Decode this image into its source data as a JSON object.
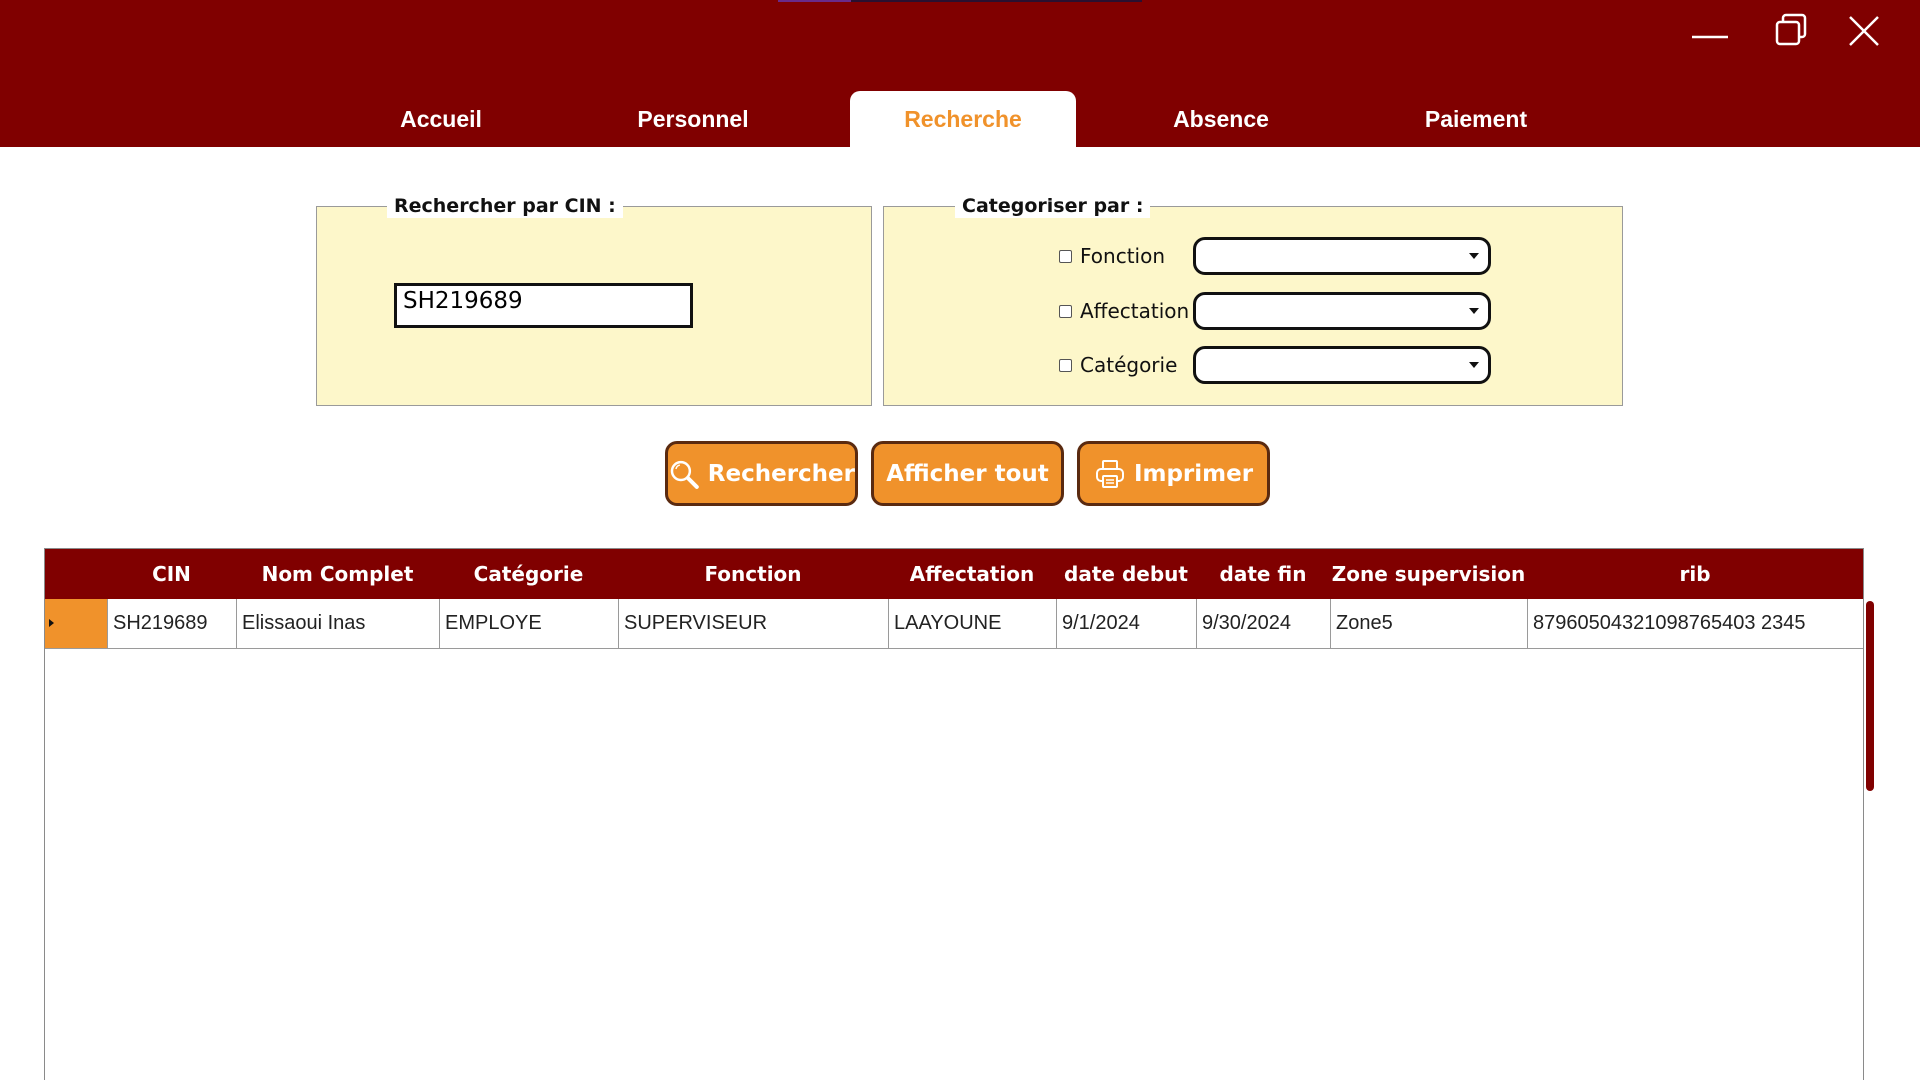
{
  "window": {
    "minimize_icon": "minimize-icon",
    "maximize_icon": "restore-icon",
    "close_icon": "close-icon"
  },
  "tabs": [
    {
      "label": "Accueil",
      "active": false
    },
    {
      "label": "Personnel",
      "active": false
    },
    {
      "label": "Recherche",
      "active": true
    },
    {
      "label": "Absence",
      "active": false
    },
    {
      "label": "Paiement",
      "active": false
    }
  ],
  "search_cin": {
    "legend": "Rechercher par CIN :",
    "value": "SH219689"
  },
  "categorize": {
    "legend": "Categoriser par :",
    "filters": [
      {
        "label": "Fonction",
        "checked": false,
        "selected": ""
      },
      {
        "label": "Affectation",
        "checked": false,
        "selected": ""
      },
      {
        "label": "Catégorie",
        "checked": false,
        "selected": ""
      }
    ]
  },
  "actions": {
    "search_label": "Rechercher",
    "show_all_label": "Afficher tout",
    "print_label": "Imprimer"
  },
  "table": {
    "columns": [
      "CIN",
      "Nom Complet",
      "Catégorie",
      "Fonction",
      "Affectation",
      "date debut",
      "date fin",
      "Zone supervision",
      "rib"
    ],
    "rows": [
      [
        "SH219689",
        "Elissaoui Inas",
        "EMPLOYE",
        "SUPERVISEUR",
        "LAAYOUNE",
        "9/1/2024",
        "9/30/2024",
        "Zone5",
        "87960504321098765403 2345"
      ]
    ]
  },
  "colors": {
    "primary": "#800000",
    "accent": "#f0922b",
    "panel": "#fdf7ca"
  }
}
